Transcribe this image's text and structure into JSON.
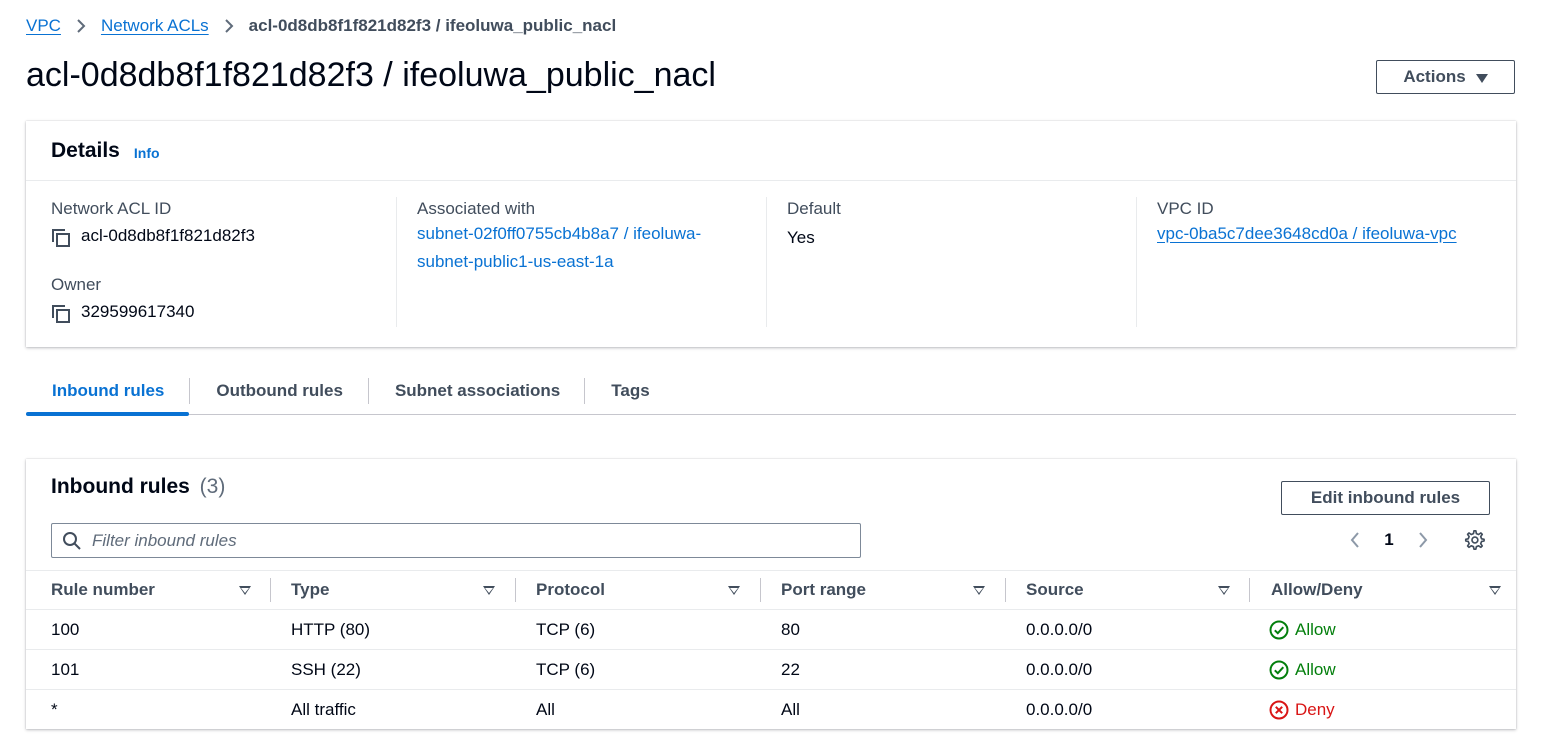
{
  "breadcrumb": {
    "vpc": "VPC",
    "nacls": "Network ACLs",
    "current": "acl-0d8db8f1f821d82f3 / ifeoluwa_public_nacl"
  },
  "page": {
    "title": "acl-0d8db8f1f821d82f3 / ifeoluwa_public_nacl",
    "actions_label": "Actions"
  },
  "details": {
    "title": "Details",
    "info": "Info",
    "nacl_id_label": "Network ACL ID",
    "nacl_id": "acl-0d8db8f1f821d82f3",
    "owner_label": "Owner",
    "owner": "329599617340",
    "associated_label": "Associated with",
    "associated_line1": "subnet-02f0ff0755cb4b8a7 / ifeoluwa-",
    "associated_line2": "subnet-public1-us-east-1a",
    "default_label": "Default",
    "default_value": "Yes",
    "vpc_id_label": "VPC ID",
    "vpc_id": "vpc-0ba5c7dee3648cd0a / ifeoluwa-vpc"
  },
  "tabs": [
    {
      "label": "Inbound rules",
      "active": true
    },
    {
      "label": "Outbound rules",
      "active": false
    },
    {
      "label": "Subnet associations",
      "active": false
    },
    {
      "label": "Tags",
      "active": false
    }
  ],
  "rules": {
    "title": "Inbound rules",
    "count": "(3)",
    "edit_label": "Edit inbound rules",
    "filter_placeholder": "Filter inbound rules",
    "page": "1",
    "columns": [
      "Rule number",
      "Type",
      "Protocol",
      "Port range",
      "Source",
      "Allow/Deny"
    ],
    "rows": [
      {
        "rule": "100",
        "type": "HTTP (80)",
        "protocol": "TCP (6)",
        "port": "80",
        "source": "0.0.0.0/0",
        "action": "Allow"
      },
      {
        "rule": "101",
        "type": "SSH (22)",
        "protocol": "TCP (6)",
        "port": "22",
        "source": "0.0.0.0/0",
        "action": "Allow"
      },
      {
        "rule": "*",
        "type": "All traffic",
        "protocol": "All",
        "port": "All",
        "source": "0.0.0.0/0",
        "action": "Deny"
      }
    ]
  },
  "colors": {
    "link": "#0972d3",
    "allow": "#037f0c",
    "deny": "#d91515"
  }
}
